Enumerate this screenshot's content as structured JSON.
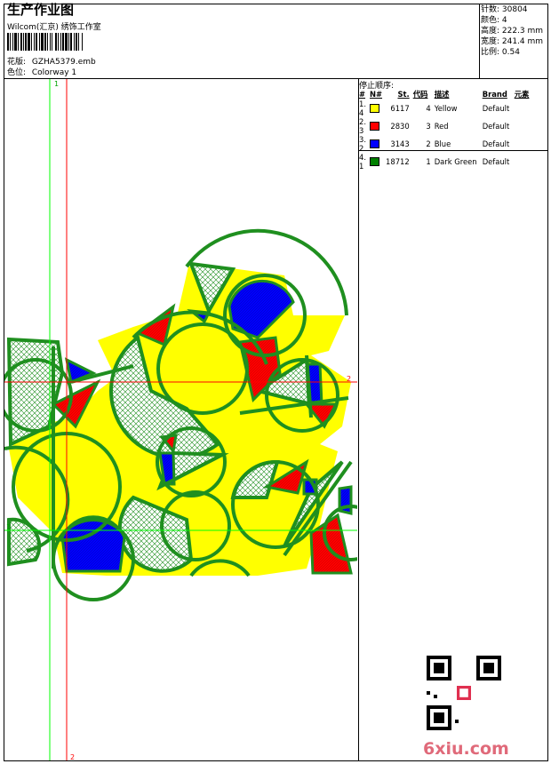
{
  "header": {
    "title": "生产作业图",
    "company": "Wilcom(汇京) 绣饰工作室",
    "design_label": "花版:",
    "design_file": "GZHA5379.emb",
    "colorway_label": "色位:",
    "colorway_value": "Colorway 1"
  },
  "stats": {
    "stitches": "针数: 30804",
    "colors": "颜色: 4",
    "height": "高度: 222.3 mm",
    "width": "宽度: 241.4 mm",
    "scale": "比例: 0.54"
  },
  "stop_sequence": {
    "title": "停止顺序:",
    "headers": [
      "#",
      "N#",
      "St.",
      "代码",
      "描述",
      "Brand",
      "元素"
    ],
    "rows": [
      {
        "index": "1. 4",
        "color": "#ffff00",
        "stitches": "6117",
        "code": "4",
        "desc": "Yellow",
        "brand": "Default"
      },
      {
        "index": "2. 3",
        "color": "#ff0000",
        "stitches": "2830",
        "code": "3",
        "desc": "Red",
        "brand": "Default"
      },
      {
        "index": "3. 2",
        "color": "#0000ff",
        "stitches": "3143",
        "code": "2",
        "desc": "Blue",
        "brand": "Default"
      },
      {
        "index": "4. 1",
        "color": "#008000",
        "stitches": "18712",
        "code": "1",
        "desc": "Dark Green",
        "brand": "Default"
      }
    ]
  },
  "guides": {
    "green_label": "1",
    "red_label": "2"
  },
  "watermark": "6xiu.com",
  "colors": {
    "yellow": "#ffff00",
    "red": "#ff0000",
    "blue": "#0000ff",
    "green": "#1f8f1f",
    "guide_red": "#ff0000",
    "guide_green": "#00ff00"
  }
}
